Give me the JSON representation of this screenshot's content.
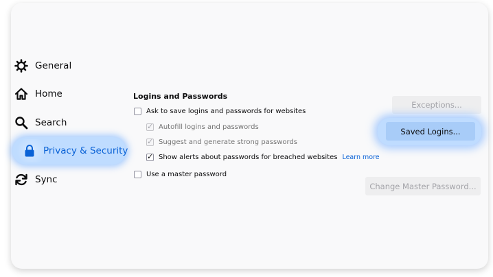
{
  "sidebar": {
    "items": [
      {
        "label": "General",
        "icon": "gear-icon"
      },
      {
        "label": "Home",
        "icon": "home-icon"
      },
      {
        "label": "Search",
        "icon": "search-icon"
      },
      {
        "label": "Privacy & Security",
        "icon": "lock-icon",
        "selected": true
      },
      {
        "label": "Sync",
        "icon": "sync-icon"
      }
    ]
  },
  "logins": {
    "title": "Logins and Passwords",
    "options": [
      {
        "label": "Ask to save logins and passwords for websites",
        "checked": false,
        "disabled": false
      },
      {
        "label": "Autofill logins and passwords",
        "checked": true,
        "disabled": true
      },
      {
        "label": "Suggest and generate strong passwords",
        "checked": true,
        "disabled": true
      },
      {
        "label": "Show alerts about passwords for breached websites",
        "checked": true,
        "disabled": false
      },
      {
        "label": "Use a master password",
        "checked": false,
        "disabled": false
      }
    ],
    "learn_more": "Learn more"
  },
  "buttons": {
    "exceptions": "Exceptions...",
    "saved_logins": "Saved Logins...",
    "change_master": "Change Master Password..."
  },
  "colors": {
    "accent": "#0a62d6",
    "highlight": "#bfdcff"
  }
}
